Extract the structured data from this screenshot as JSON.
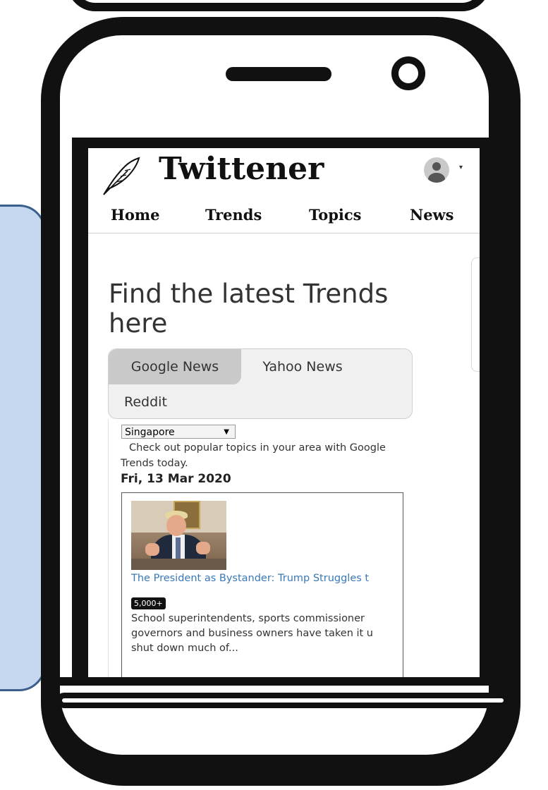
{
  "brand": {
    "name": "Twittener"
  },
  "nav": {
    "items": [
      "Home",
      "Trends",
      "Topics",
      "News"
    ]
  },
  "hero": {
    "title": "Find the latest Trends here"
  },
  "tabs": {
    "items": [
      "Google News",
      "Yahoo News",
      "Reddit"
    ],
    "active": "Google News"
  },
  "region": {
    "selected": "Singapore"
  },
  "description": "Check out popular topics in your area with Google Trends today.",
  "date": "Fri, 13 Mar 2020",
  "article": {
    "headline": "The President as Bystander: Trump Struggles t",
    "badge": "5,000+",
    "snippet_lines": [
      "School superintendents, sports commissioner",
      "governors and business owners have taken it u",
      "shut down much of..."
    ]
  },
  "icons": [
    "feather-icon",
    "user-avatar-icon",
    "dropdown-caret-icon"
  ],
  "colors": {
    "link": "#3a78b8",
    "panel": "#c6d8ef",
    "tab_active": "#c9c9c9"
  }
}
